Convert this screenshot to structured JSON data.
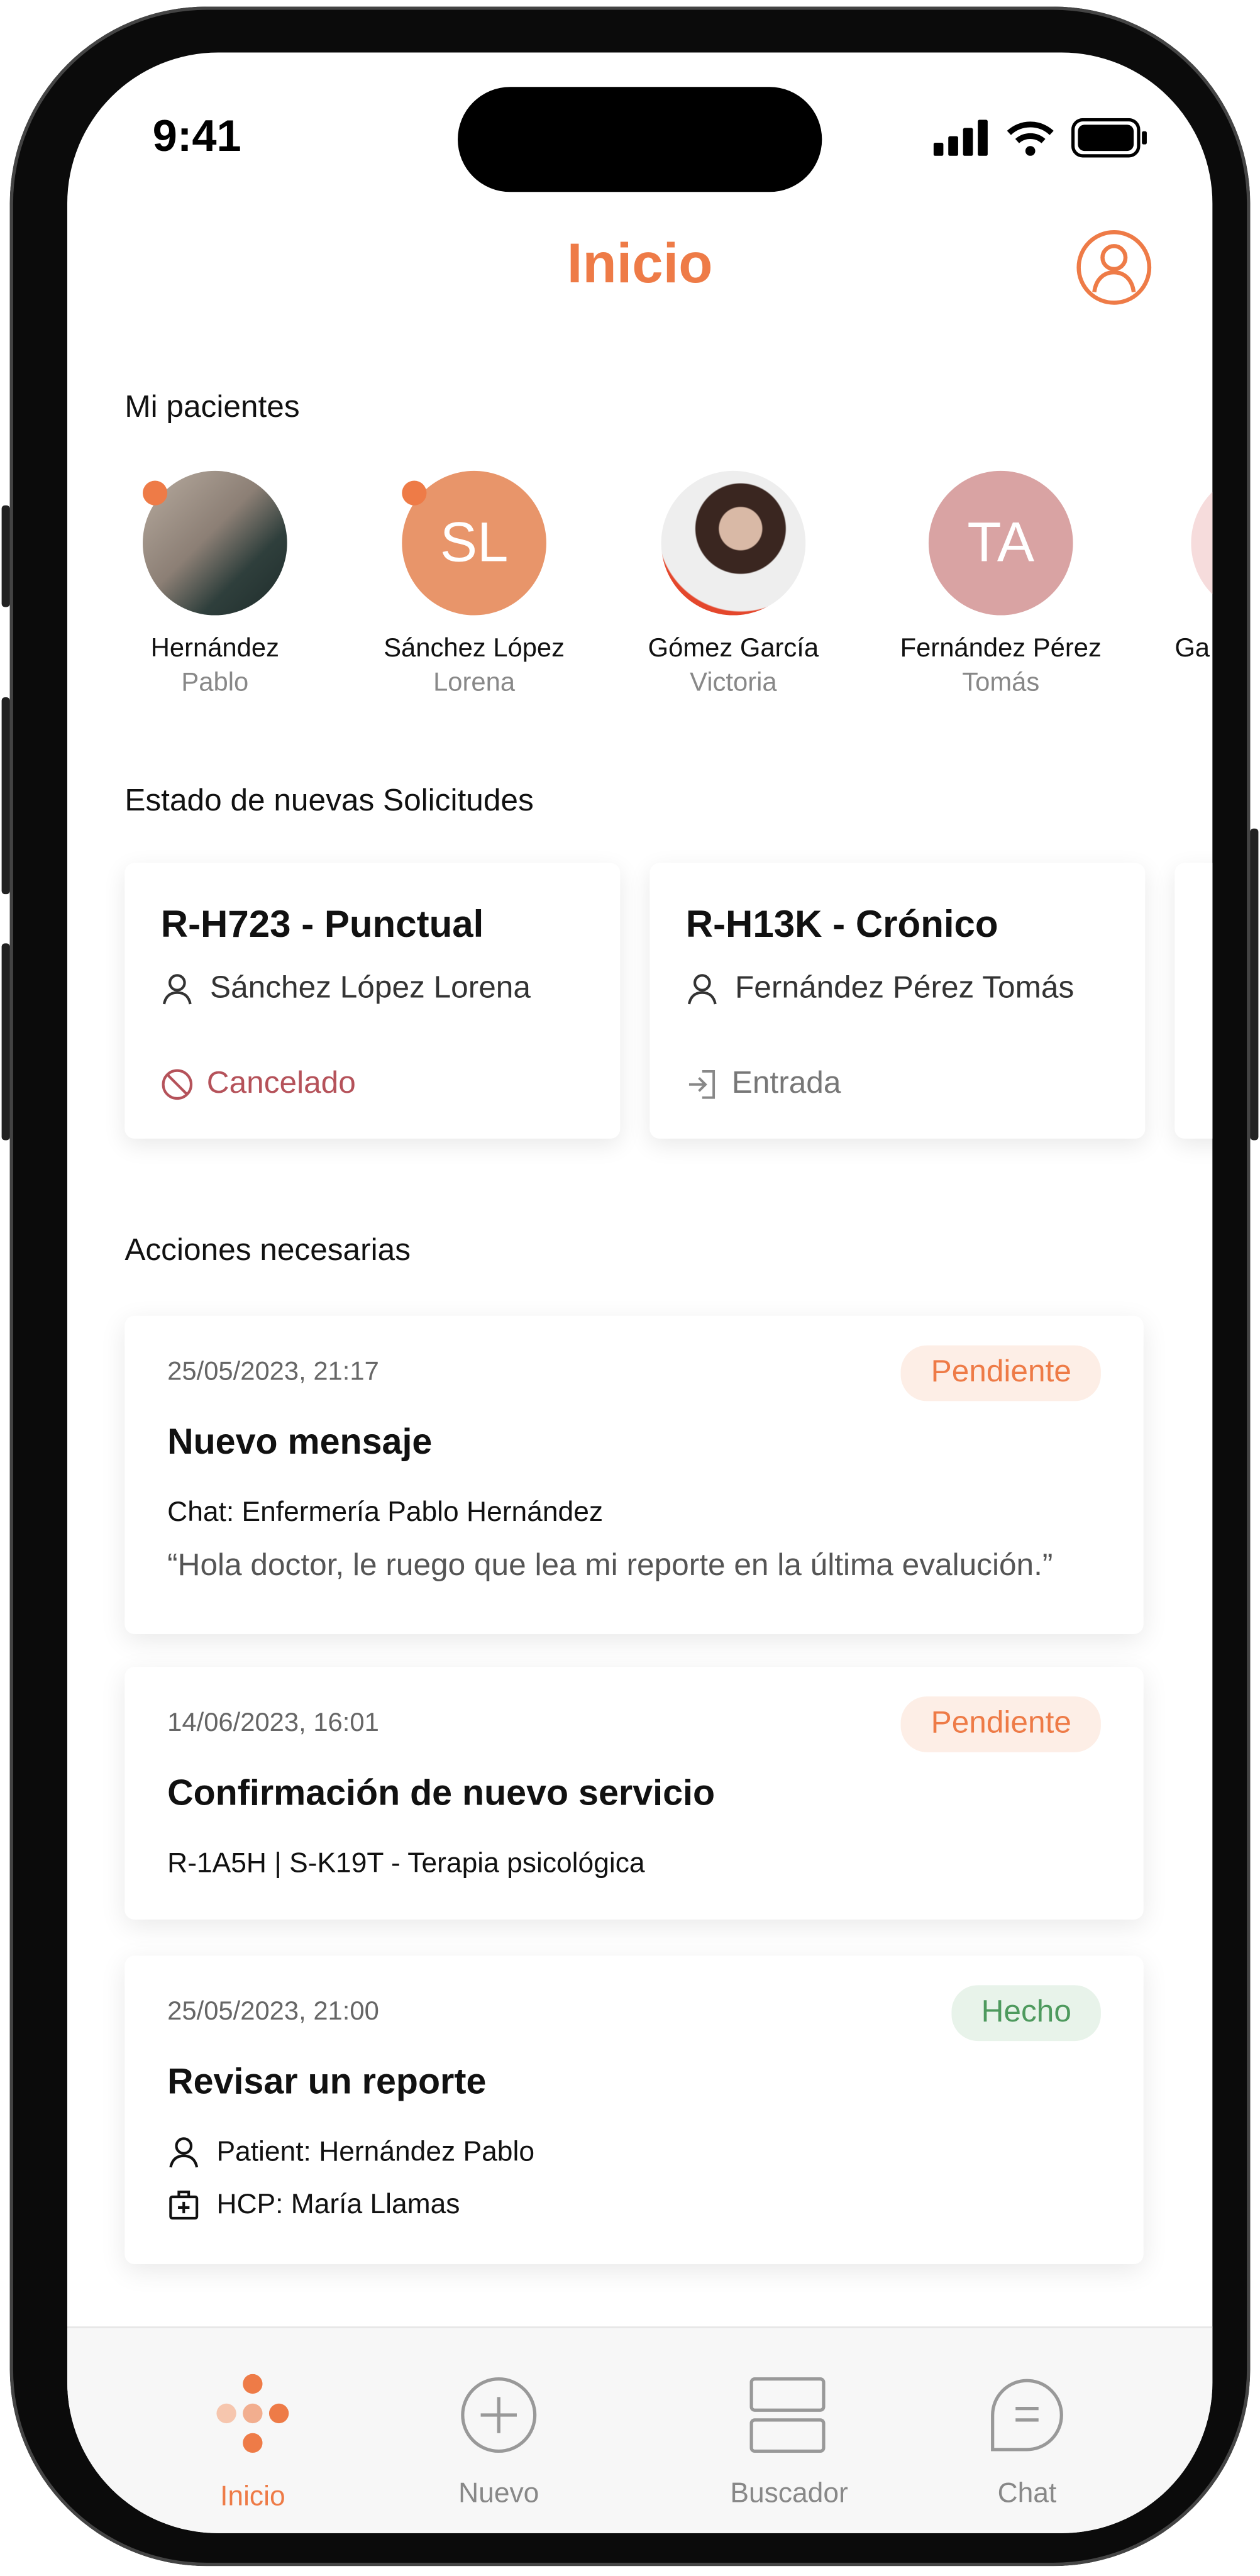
{
  "status_bar": {
    "time": "9:41"
  },
  "header": {
    "title": "Inicio",
    "profile_icon": "user-circle-icon"
  },
  "colors": {
    "accent": "#EE7B47",
    "cancel": "#B5525A",
    "pending_bg": "#FDEEE6",
    "done_bg": "#E8F3EA",
    "done_text": "#4E9A5E"
  },
  "patients": {
    "heading": "Mi pacientes",
    "items": [
      {
        "last": "Hernández",
        "first": "Pablo",
        "photo": true,
        "unread": true
      },
      {
        "last": "Sánchez López",
        "first": "Lorena",
        "initials": "SL",
        "color": "#E8956A",
        "unread": true
      },
      {
        "last": "Gómez García",
        "first": "Victoria",
        "photo": true,
        "unread": false
      },
      {
        "last": "Fernández Pérez",
        "first": "Tomás",
        "initials": "TA",
        "color": "#D9A3A3",
        "unread": false
      },
      {
        "last": "Ga",
        "first": "",
        "color": "#F6DCDC",
        "unread": false
      }
    ]
  },
  "requests": {
    "heading": "Estado de nuevas Solicitudes",
    "items": [
      {
        "title": "R-H723 - Punctual",
        "patient": "Sánchez López Lorena",
        "status": "Cancelado",
        "status_icon": "ban-icon"
      },
      {
        "title": "R-H13K - Crónico",
        "patient": "Fernández Pérez Tomás",
        "status": "Entrada",
        "status_icon": "sign-in-icon"
      }
    ]
  },
  "actions": {
    "heading": "Acciones necesarias",
    "items": [
      {
        "date": "25/05/2023, 21:17",
        "badge": "Pendiente",
        "title": "Nuevo mensaje",
        "line1": "Chat: Enfermería Pablo Hernández",
        "line2": "“Hola doctor, le ruego que lea mi reporte en la última evalución.”"
      },
      {
        "date": "14/06/2023, 16:01",
        "badge": "Pendiente",
        "title": "Confirmación de nuevo servicio",
        "line1": "R-1A5H | S-K19T - Terapia psicológica"
      },
      {
        "date": "25/05/2023, 21:00",
        "badge": "Hecho",
        "title": "Revisar un reporte",
        "line1": "Patient: Hernández Pablo",
        "line2": "HCP: María Llamas"
      }
    ]
  },
  "tabbar": {
    "items": [
      {
        "label": "Inicio",
        "icon": "home-dots-icon",
        "active": true
      },
      {
        "label": "Nuevo",
        "icon": "plus-circle-icon"
      },
      {
        "label": "Buscador",
        "icon": "search-grid-icon"
      },
      {
        "label": "Chat",
        "icon": "chat-bubble-icon"
      }
    ]
  }
}
